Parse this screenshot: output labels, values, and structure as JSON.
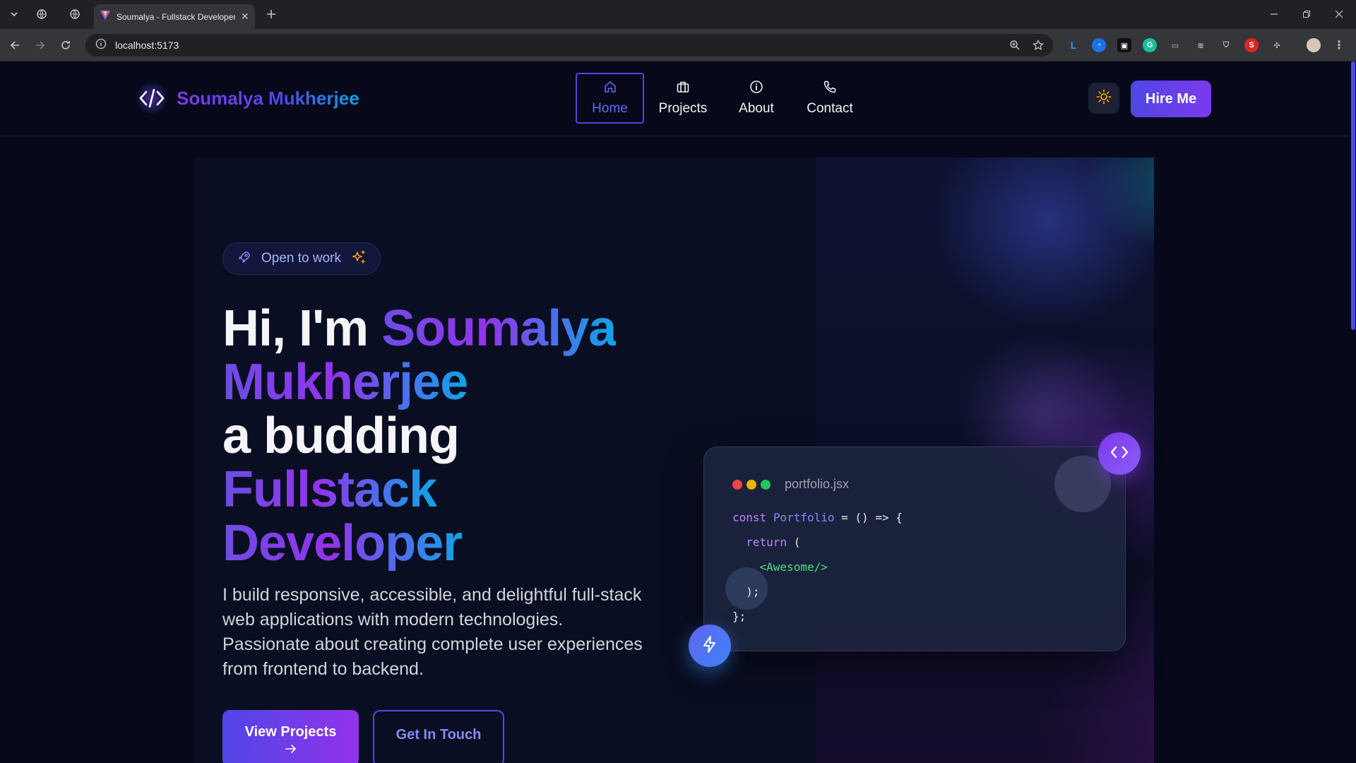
{
  "browser": {
    "tab_title": "Soumalya - Fullstack Developer",
    "url": "localhost:5173"
  },
  "header": {
    "logo_text": "Soumalya Mukherjee",
    "nav": [
      {
        "label": "Home",
        "icon": "home-icon",
        "active": true
      },
      {
        "label": "Projects",
        "icon": "briefcase-icon",
        "active": false
      },
      {
        "label": "About",
        "icon": "info-icon",
        "active": false
      },
      {
        "label": "Contact",
        "icon": "phone-icon",
        "active": false
      }
    ],
    "theme_icon": "sun-icon",
    "hire_label": "Hire Me"
  },
  "hero": {
    "badge": "Open to work",
    "headline": {
      "greeting": "Hi, I'm",
      "first_name": "Soumalya",
      "last_name": "Mukherjee",
      "line3": "a budding",
      "role1": "Fullstack",
      "role2": "Developer"
    },
    "description": "I build responsive, accessible, and delightful full-stack web applications with modern technologies. Passionate about creating complete user experiences from frontend to backend.",
    "primary_button": "View Projects",
    "secondary_button": "Get In Touch"
  },
  "code_card": {
    "filename": "portfolio.jsx",
    "code": {
      "kw_const": "const",
      "fn_name": "Portfolio",
      "line1_rest": " = () => {",
      "kw_return": "return",
      "line2_rest": " (",
      "tag": "<Awesome/>",
      "line4": ");",
      "line5": "};"
    }
  },
  "colors": {
    "accent": "#4f46e5",
    "accent2": "#7c3aed",
    "teal": "#0ea5e9",
    "background": "#07091a",
    "dot_red": "#ef4444",
    "dot_yellow": "#eab308",
    "dot_green": "#22c55e"
  }
}
